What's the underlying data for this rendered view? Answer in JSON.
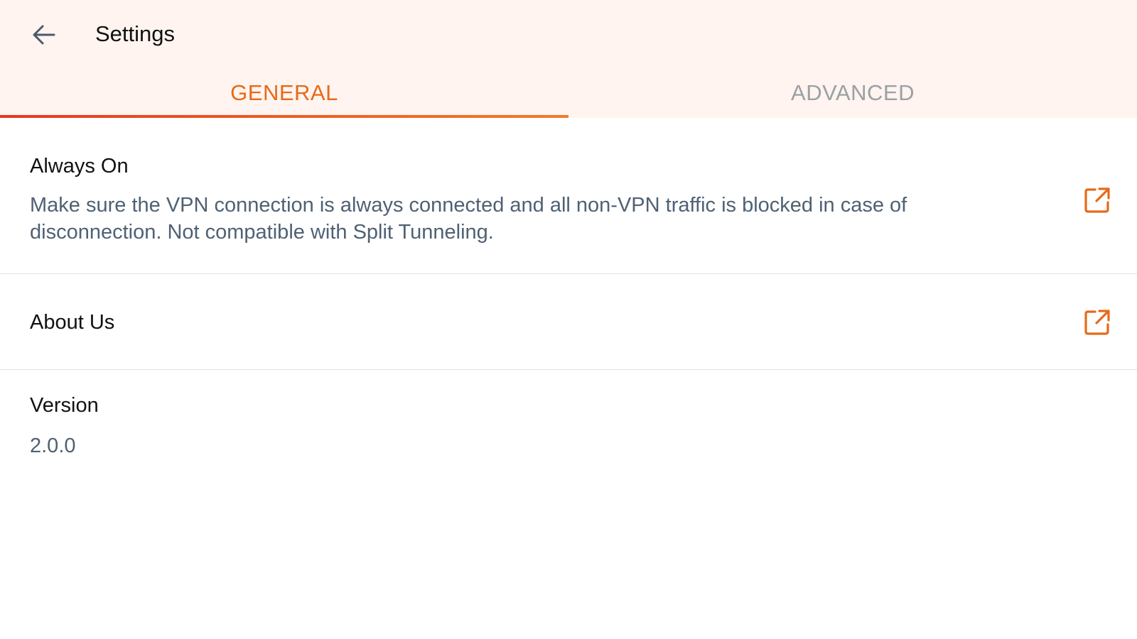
{
  "header": {
    "title": "Settings",
    "back_icon": "arrow-left-icon"
  },
  "tabs": [
    {
      "label": "GENERAL",
      "active": true
    },
    {
      "label": "ADVANCED",
      "active": false
    }
  ],
  "settings": {
    "always_on": {
      "title": "Always On",
      "description": "Make sure the VPN connection is always connected and all non-VPN traffic is blocked in case of disconnection. Not compatible with Split Tunneling.",
      "icon": "external-link-icon"
    },
    "about_us": {
      "title": "About Us",
      "icon": "external-link-icon"
    },
    "version": {
      "title": "Version",
      "value": "2.0.0"
    }
  },
  "colors": {
    "accent": "#e56a1a",
    "header_bg": "#fff4ef",
    "inactive_tab": "#9aa0a6",
    "secondary_text": "#4f6174",
    "indicator_start": "#e8351f",
    "indicator_end": "#f27a2a"
  }
}
